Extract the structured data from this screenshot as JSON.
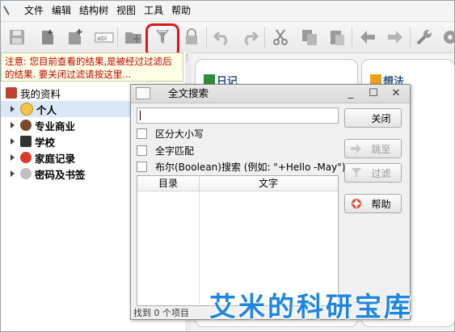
{
  "menu": {
    "items": [
      "文件",
      "编辑",
      "结构树",
      "视图",
      "工具",
      "帮助"
    ]
  },
  "toolbar": {
    "icons": [
      "save-icon",
      "new-sibling-icon",
      "new-child-icon",
      "rename-icon",
      "open-folder-icon",
      "filter-icon",
      "lock-icon",
      "undo-icon",
      "redo-icon",
      "cut-icon",
      "copy-icon",
      "paste-icon",
      "back-icon",
      "forward-icon",
      "tools-icon",
      "settings-icon"
    ],
    "accent": "#e0141e"
  },
  "notice": {
    "text": "注意: 您目前查看的结果,是被经过过滤后的结果. 要关闭过滤请按这里..."
  },
  "tree": {
    "root": "我的资料",
    "children": [
      "个人",
      "专业商业",
      "学校",
      "家庭记录",
      "密码及书签"
    ],
    "selected": "个人"
  },
  "cards": {
    "diary": "日记",
    "ideas": "想法"
  },
  "dialog": {
    "title": "全文搜索",
    "window_buttons": {
      "minimize": "_",
      "maximize": "☐",
      "close": "✕"
    },
    "search_value": "",
    "options": [
      "区分大小写",
      "全字匹配",
      "布尔(Boolean)搜索 (例如: \"+Hello -May\")"
    ],
    "columns": [
      "目录",
      "文字"
    ],
    "status": "找到 0 个项目",
    "buttons": {
      "close": "关闭",
      "jump": "跳至",
      "filter": "过滤",
      "help": "帮助"
    }
  },
  "watermark": "艾米的科研宝库"
}
